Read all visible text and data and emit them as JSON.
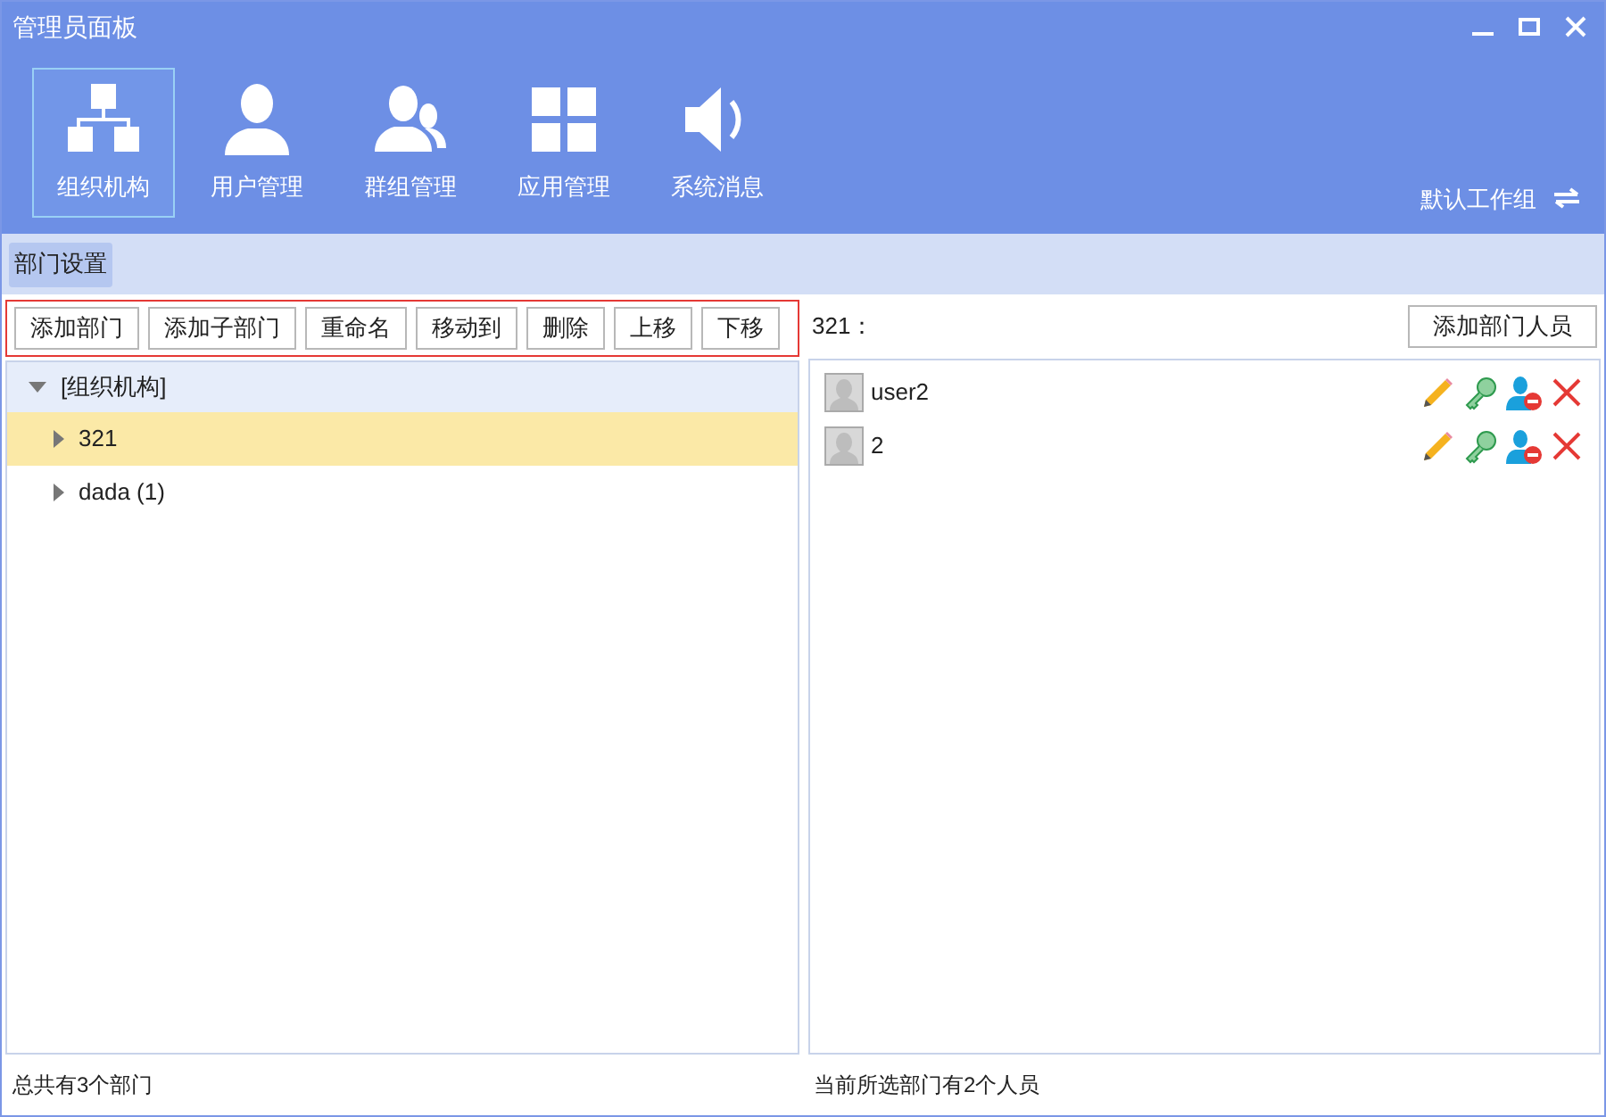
{
  "window": {
    "title": "管理员面板"
  },
  "nav": [
    {
      "label": "组织机构",
      "kind": "org",
      "selected": true
    },
    {
      "label": "用户管理",
      "kind": "user",
      "selected": false
    },
    {
      "label": "群组管理",
      "kind": "group",
      "selected": false
    },
    {
      "label": "应用管理",
      "kind": "apps",
      "selected": false
    },
    {
      "label": "系统消息",
      "kind": "sound",
      "selected": false
    }
  ],
  "workgroup": "默认工作组",
  "subtabs": [
    {
      "label": "部门设置",
      "selected": true
    }
  ],
  "toolbar": [
    "添加部门",
    "添加子部门",
    "重命名",
    "移动到",
    "删除",
    "上移",
    "下移"
  ],
  "tree": {
    "label": "[组织机构]",
    "expanded": true,
    "children": [
      {
        "label": "321",
        "expanded": false,
        "selected": true
      },
      {
        "label": "dada (1)",
        "expanded": false,
        "selected": false
      }
    ]
  },
  "members_header": {
    "label": "321：",
    "add_button": "添加部门人员"
  },
  "members": [
    {
      "name": "user2"
    },
    {
      "name": "2"
    }
  ],
  "status_left": "总共有3个部门",
  "status_right": "当前所选部门有2个人员"
}
